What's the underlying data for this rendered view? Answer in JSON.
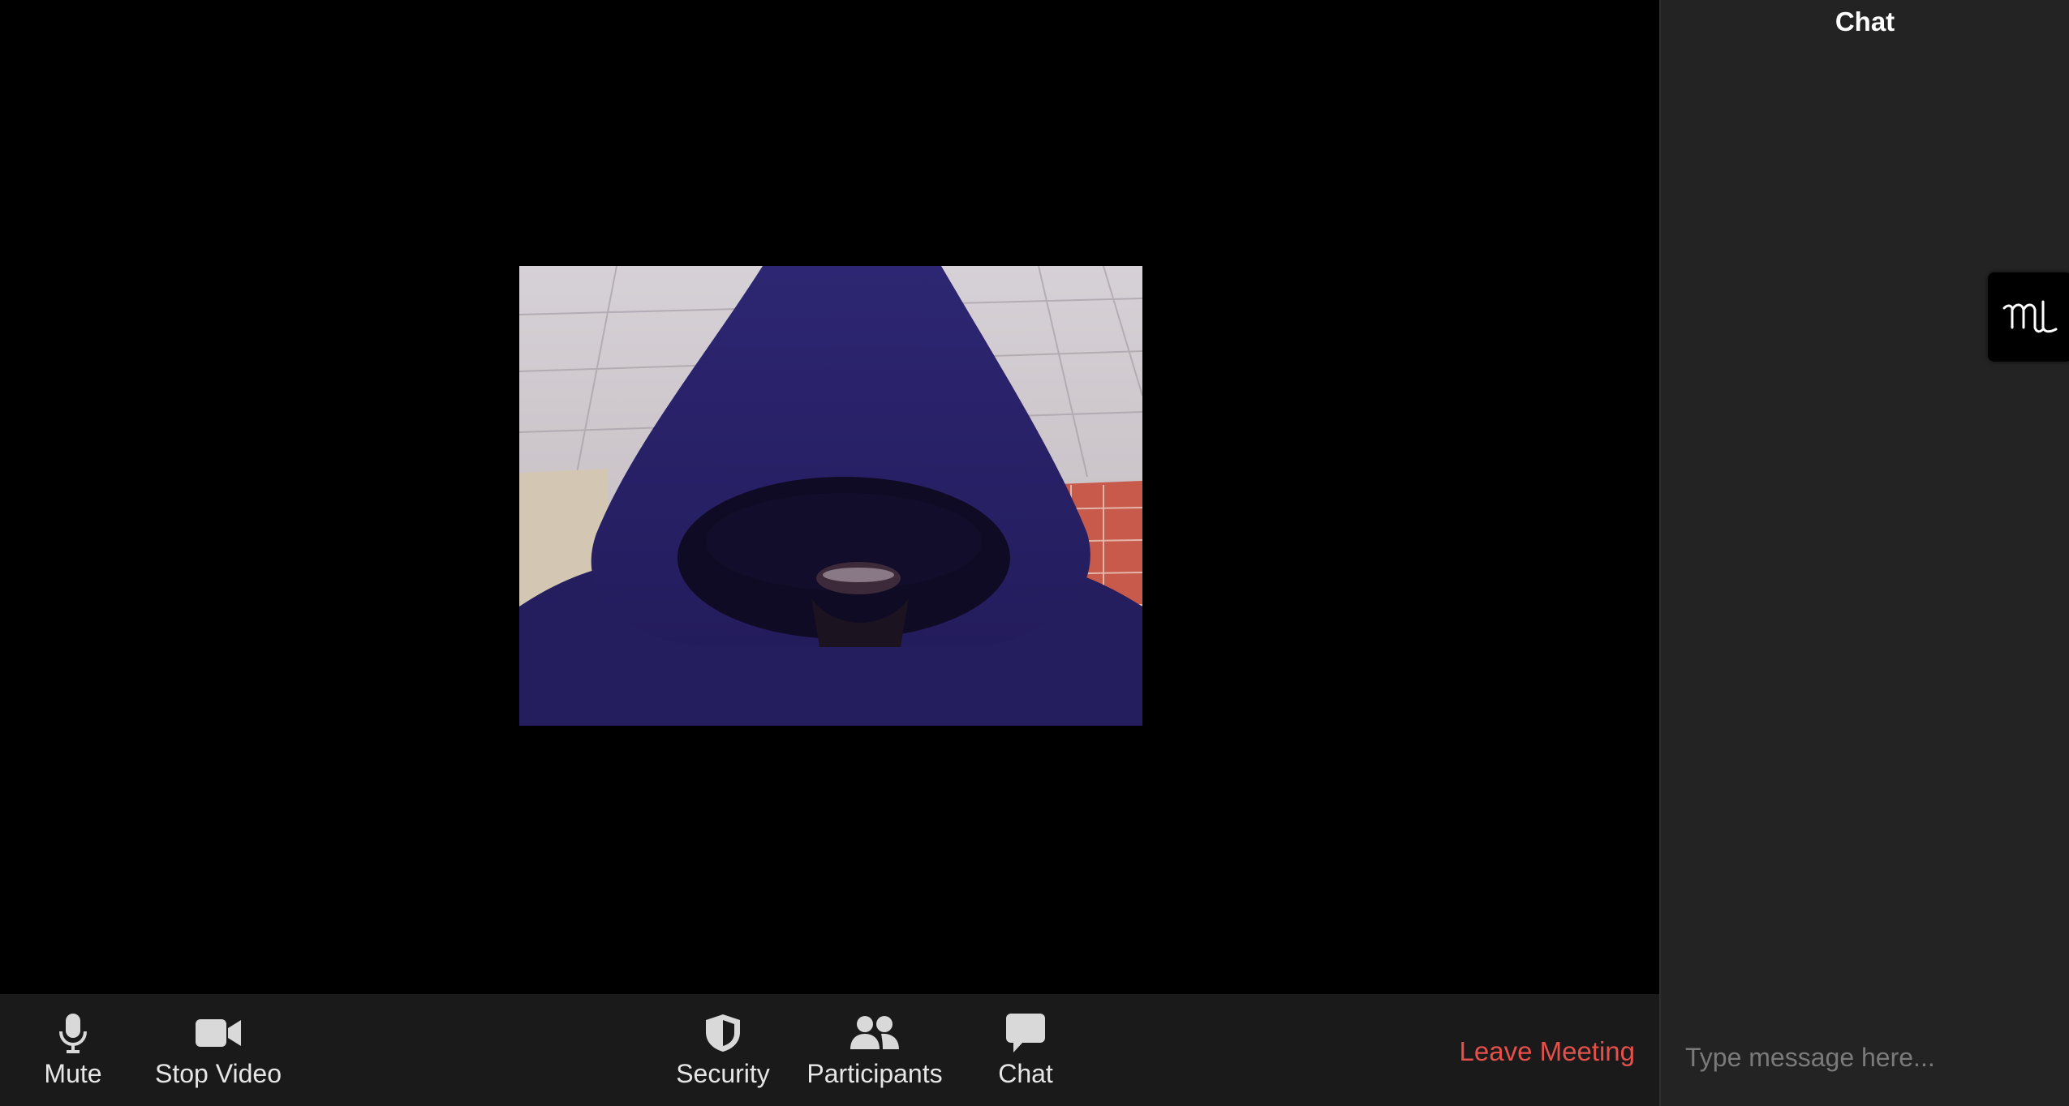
{
  "video": {
    "participant_tile": "self-view"
  },
  "toolbar": {
    "mute_label": "Mute",
    "stop_video_label": "Stop Video",
    "security_label": "Security",
    "participants_label": "Participants",
    "chat_label": "Chat",
    "leave_label": "Leave Meeting",
    "leave_color": "#e5504a",
    "icons": {
      "mute": "microphone-icon",
      "video": "video-camera-icon",
      "security": "shield-icon",
      "participants": "participants-icon",
      "chat": "chat-bubble-icon"
    }
  },
  "chat_panel": {
    "title": "Chat",
    "input_placeholder": "Type message here...",
    "input_value": ""
  },
  "float_badge": {
    "icon": "signature-logo-icon"
  }
}
